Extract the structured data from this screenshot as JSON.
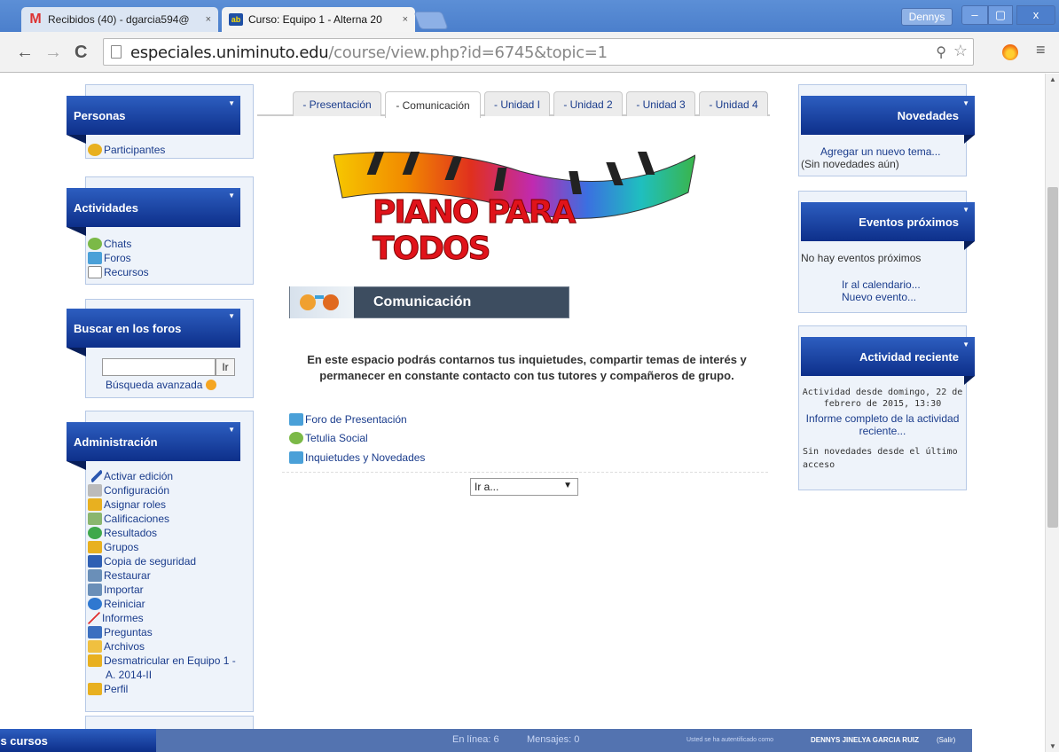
{
  "browser": {
    "tabs": [
      {
        "title": "Recibidos (40) - dgarcia594@",
        "icon": "gmail-icon"
      },
      {
        "title": "Curso: Equipo 1 - Alterna 20",
        "icon": "moodle-icon"
      }
    ],
    "tab_close": "×",
    "user": "Dennys",
    "window_buttons": {
      "minimize": "–",
      "maximize": "▢",
      "close": "x"
    },
    "nav": {
      "back": "←",
      "forward": "→",
      "reload": "C"
    },
    "url_domain": "especiales.uniminuto.edu",
    "url_path": "/course/view.php?id=6745&topic=1",
    "menu": "≡",
    "zoom": "⚲",
    "star": "☆"
  },
  "left": {
    "personas": {
      "title": "Personas",
      "items": [
        "Participantes"
      ]
    },
    "actividades": {
      "title": "Actividades",
      "items": [
        "Chats",
        "Foros",
        "Recursos"
      ]
    },
    "buscar": {
      "title": "Buscar en los foros",
      "button": "Ir",
      "advanced": "Búsqueda avanzada",
      "value": ""
    },
    "admin": {
      "title": "Administración",
      "items": [
        "Activar edición",
        "Configuración",
        "Asignar roles",
        "Calificaciones",
        "Resultados",
        "Grupos",
        "Copia de seguridad",
        "Restaurar",
        "Importar",
        "Reiniciar",
        "Informes",
        "Preguntas",
        "Archivos",
        "Desmatricular en Equipo 1 -",
        "A. 2014-II",
        "Perfil"
      ]
    },
    "mis_cursos": "Mis cursos"
  },
  "course_tabs": [
    "- Presentación",
    "- Comunicación",
    "- Unidad I",
    "- Unidad 2",
    "- Unidad 3",
    "- Unidad 4"
  ],
  "banner_text": "PIANO PARA TODOS",
  "section": {
    "title": "Comunicación"
  },
  "intro": "En este espacio podrás contarnos tus inquietudes, compartir temas de interés y permanecer en constante contacto con tus tutores y compañeros de grupo.",
  "activities": [
    "Foro de Presentación",
    "Tetulia Social",
    "Inquietudes y Novedades"
  ],
  "jump": {
    "selected": "Ir a...",
    "caret": "▼"
  },
  "right": {
    "novedades": {
      "title": "Novedades",
      "add": "Agregar un nuevo tema...",
      "none": "(Sin novedades aún)"
    },
    "eventos": {
      "title": "Eventos próximos",
      "none": "No hay eventos próximos",
      "calendar": "Ir al calendario...",
      "new": "Nuevo evento..."
    },
    "actividad": {
      "title": "Actividad reciente",
      "since": "Actividad desde domingo, 22 de febrero de 2015, 13:30",
      "report": "Informe completo de la actividad reciente...",
      "none": "Sin novedades desde el último acceso"
    }
  },
  "footer": {
    "online": "En línea: 6",
    "messages": "Mensajes: 0",
    "auth_prefix": "Usted se ha autentificado como",
    "user": "DENNYS JINELYA GARCIA RUIZ",
    "logout": "(Salir)"
  },
  "colors": {
    "block_header": "#0d2f8a",
    "footer_bar": "#5373b0",
    "link": "#1a3c8c"
  }
}
